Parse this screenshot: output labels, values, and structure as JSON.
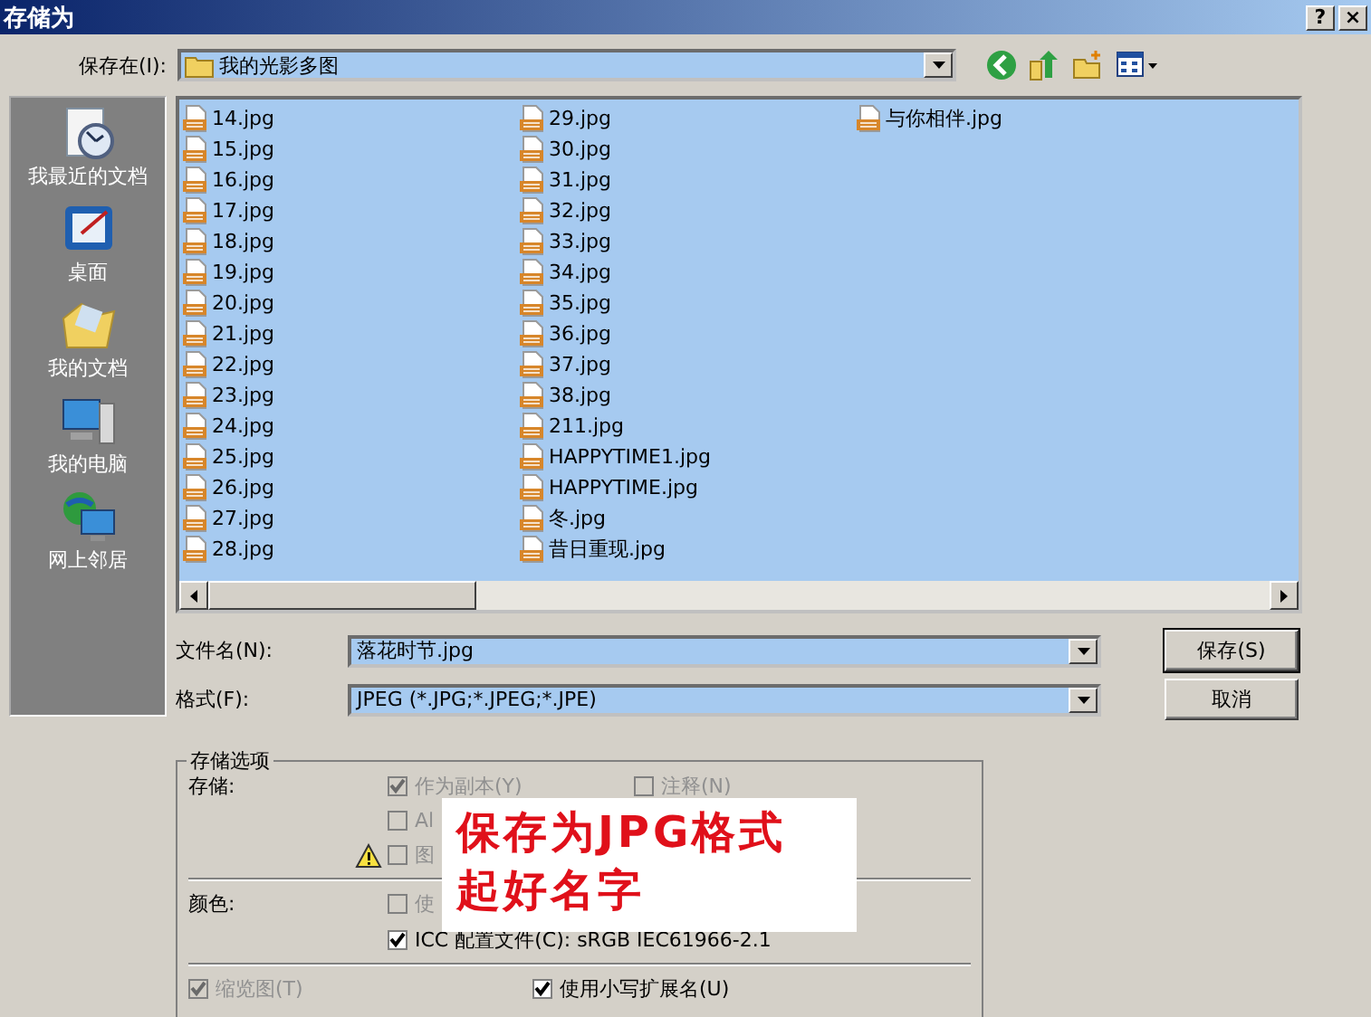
{
  "window": {
    "title": "存储为",
    "buttons": [
      "?",
      "×"
    ]
  },
  "location": {
    "label": "保存在(I):",
    "value": "我的光影多图"
  },
  "places": [
    {
      "label": "我最近的文档",
      "kind": "recent"
    },
    {
      "label": "桌面",
      "kind": "desktop"
    },
    {
      "label": "我的文档",
      "kind": "documents"
    },
    {
      "label": "我的电脑",
      "kind": "computer"
    },
    {
      "label": "网上邻居",
      "kind": "network"
    }
  ],
  "files": [
    [
      "14.jpg",
      "15.jpg",
      "16.jpg",
      "17.jpg",
      "18.jpg",
      "19.jpg",
      "20.jpg",
      "21.jpg",
      "22.jpg",
      "23.jpg",
      "24.jpg",
      "25.jpg",
      "26.jpg",
      "27.jpg",
      "28.jpg"
    ],
    [
      "29.jpg",
      "30.jpg",
      "31.jpg",
      "32.jpg",
      "33.jpg",
      "34.jpg",
      "35.jpg",
      "36.jpg",
      "37.jpg",
      "38.jpg",
      "211.jpg",
      "HAPPYTIME1.jpg",
      "HAPPYTIME.jpg",
      "冬.jpg",
      "昔日重现.jpg"
    ],
    [
      "与你相伴.jpg"
    ]
  ],
  "filename": {
    "label": "文件名(N):",
    "value": "落花时节.jpg"
  },
  "format": {
    "label": "格式(F):",
    "value": "JPEG (*.JPG;*.JPEG;*.JPE)"
  },
  "buttons": [
    "保存(S)",
    "取消"
  ],
  "options": {
    "title": "存储选项",
    "save_label": "存储:",
    "color_label": "颜色:",
    "save": [
      {
        "label": "作为副本(Y)",
        "checked": true,
        "disabled": true,
        "warning": false
      },
      {
        "label": "注释(N)",
        "checked": false,
        "disabled": true,
        "warning": false
      },
      {
        "label": "Al",
        "checked": false,
        "disabled": true,
        "warning": false
      },
      {
        "label": "图",
        "checked": false,
        "disabled": true,
        "warning": true
      }
    ],
    "color": [
      {
        "label": "使",
        "checked": false,
        "disabled": true
      },
      {
        "label": "ICC 配置文件(C): sRGB IEC61966-2.1",
        "checked": true,
        "disabled": false
      }
    ],
    "bottom": [
      {
        "label": "缩览图(T)",
        "checked": true,
        "disabled": true
      },
      {
        "label": "使用小写扩展名(U)",
        "checked": true,
        "disabled": false
      }
    ]
  },
  "annotation": [
    "保存为JPG格式",
    "起好名字"
  ]
}
